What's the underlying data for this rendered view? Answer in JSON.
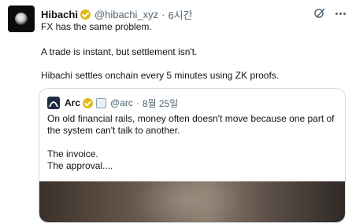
{
  "tweet": {
    "author_name": "Hibachi",
    "author_handle": "@hibachi_xyz",
    "separator": "·",
    "time": "6시간",
    "lines": [
      "FX has the same problem.",
      "A trade is instant, but settlement isn't.",
      "Hibachi settles onchain every 5 minutes using ZK proofs."
    ]
  },
  "quoted": {
    "author_name": "Arc",
    "author_handle": "@arc",
    "separator": "·",
    "date": "8월 25일",
    "lines": [
      "On old financial rails, money often doesn't move because one part of",
      "the system can't talk to another.",
      "The invoice.",
      "The approval...."
    ]
  },
  "colors": {
    "verified_badge": "#e2b719",
    "secondary_text": "#536471",
    "border": "#cfd9de"
  },
  "icons": {
    "grok": "grok-icon",
    "more": "more-icon",
    "verified": "verified-badge-icon",
    "affiliate": "affiliate-badge-icon"
  }
}
